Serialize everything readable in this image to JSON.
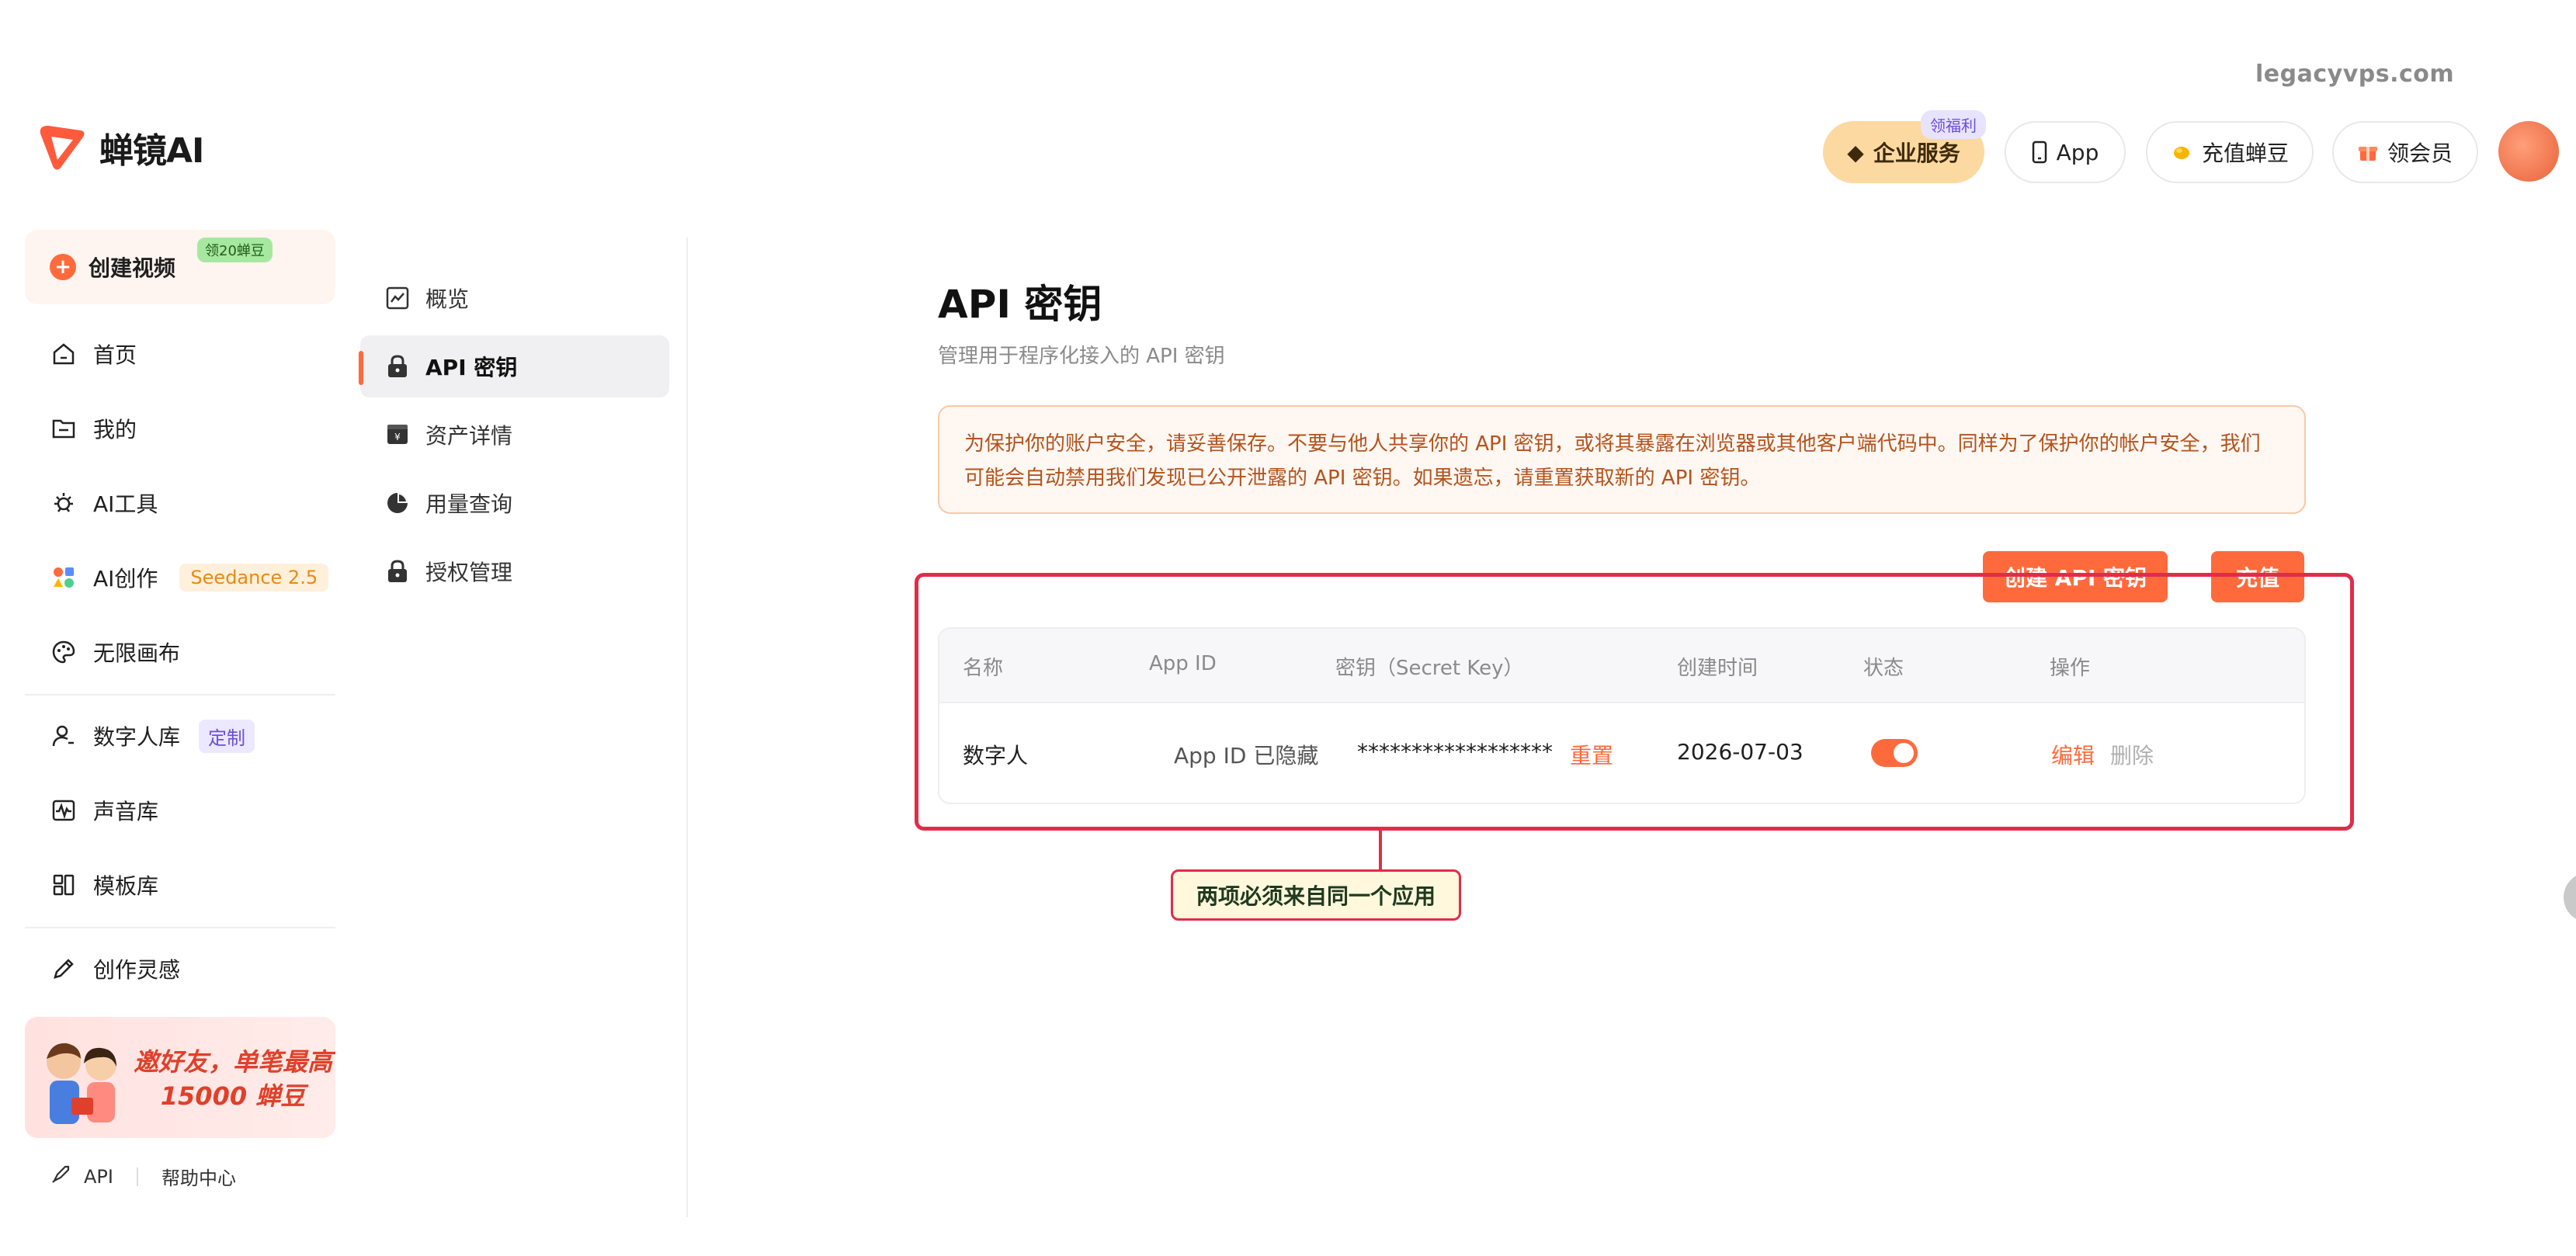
{
  "watermark": "legacyvps.com",
  "logo": {
    "text": "蝉镜AI"
  },
  "header": {
    "enterprise": {
      "label": "企业服务",
      "badge": "领福利"
    },
    "app": {
      "label": "App"
    },
    "recharge": {
      "label": "充值蝉豆"
    },
    "member": {
      "label": "领会员"
    }
  },
  "sidebar": {
    "create": {
      "label": "创建视频",
      "badge": "领20蝉豆"
    },
    "items": [
      {
        "label": "首页"
      },
      {
        "label": "我的"
      },
      {
        "label": "AI工具"
      },
      {
        "label": "AI创作",
        "tag": "Seedance 2.5"
      },
      {
        "label": "无限画布"
      },
      {
        "label": "数字人库",
        "tag": "定制"
      },
      {
        "label": "声音库"
      },
      {
        "label": "模板库"
      },
      {
        "label": "创作灵感"
      }
    ],
    "promo": {
      "line1": "邀好友，单笔最高",
      "line2": "15000 蝉豆"
    },
    "footer": {
      "api": "API",
      "help": "帮助中心"
    }
  },
  "subnav": {
    "items": [
      {
        "label": "概览"
      },
      {
        "label": "API 密钥"
      },
      {
        "label": "资产详情"
      },
      {
        "label": "用量查询"
      },
      {
        "label": "授权管理"
      }
    ]
  },
  "main": {
    "title": "API 密钥",
    "subtitle": "管理用于程序化接入的 API 密钥",
    "notice_line1": "为保护你的账户安全，请妥善保存。不要与他人共享你的 API 密钥，或将其暴露在浏览器或其他客户端代码中。同样为了保护你的帐户安全，我们",
    "notice_line2": "可能会自动禁用我们发现已公开泄露的 API 密钥。如果遗忘，请重置获取新的 API 密钥。",
    "create_button": "创建 API 密钥",
    "recharge_button": "充值",
    "table": {
      "headers": [
        "名称",
        "App ID",
        "密钥（Secret Key）",
        "创建时间",
        "状态",
        "操作"
      ],
      "row": {
        "name": "数字人",
        "app_id": "App ID 已隐藏",
        "secret": "******************",
        "reset": "重置",
        "created": "2026-07-03",
        "status_on": true,
        "edit": "编辑",
        "delete": "删除"
      }
    },
    "callout": "两项必须来自同一个应用"
  },
  "colors": {
    "accent": "#ff6a3d",
    "annotation": "#e02d4a"
  }
}
